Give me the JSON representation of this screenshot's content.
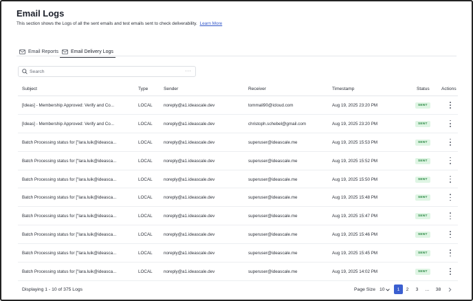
{
  "header": {
    "title": "Email Logs",
    "description": "This section shows the Logs of all the sent emails and test emails sent to check deliverability.",
    "learn_more": "Learn More"
  },
  "tabs": [
    {
      "label": "Email Reports",
      "icon": "mail-icon",
      "active": false
    },
    {
      "label": "Email Delivery Logs",
      "icon": "mail-icon",
      "active": true
    }
  ],
  "search": {
    "placeholder": "Search",
    "value": "",
    "more": "···"
  },
  "table": {
    "columns": [
      "Subject",
      "Type",
      "Sender",
      "Receiver",
      "Timestamp",
      "Status",
      "Actions"
    ],
    "rows": [
      {
        "subject": "[Ideas] - Membership Approved: Verify and Co...",
        "type": "LOCAL",
        "sender": "noreply@a1.ideascale.dev",
        "receiver": "tommali90@icloud.com",
        "timestamp": "Aug 19, 2025 23:20 PM",
        "status": "SENT"
      },
      {
        "subject": "[Ideas] - Membership Approved: Verify and Co...",
        "type": "LOCAL",
        "sender": "noreply@a1.ideascale.dev",
        "receiver": "christoph.schebel@gmail.com",
        "timestamp": "Aug 19, 2025 23:20 PM",
        "status": "SENT"
      },
      {
        "subject": "Batch Processing status for [\"lara.luik@ideasca...",
        "type": "LOCAL",
        "sender": "noreply@a1.ideascale.dev",
        "receiver": "superuser@ideascale.me",
        "timestamp": "Aug 19, 2025 15:53 PM",
        "status": "SENT"
      },
      {
        "subject": "Batch Processing status for [\"lara.luik@ideasca...",
        "type": "LOCAL",
        "sender": "noreply@a1.ideascale.dev",
        "receiver": "superuser@ideascale.me",
        "timestamp": "Aug 19, 2025 15:52 PM",
        "status": "SENT"
      },
      {
        "subject": "Batch Processing status for [\"lara.luik@ideasca...",
        "type": "LOCAL",
        "sender": "noreply@a1.ideascale.dev",
        "receiver": "superuser@ideascale.me",
        "timestamp": "Aug 19, 2025 15:50 PM",
        "status": "SENT"
      },
      {
        "subject": "Batch Processing status for [\"lara.luik@ideasca...",
        "type": "LOCAL",
        "sender": "noreply@a1.ideascale.dev",
        "receiver": "superuser@ideascale.me",
        "timestamp": "Aug 19, 2025 15:48 PM",
        "status": "SENT"
      },
      {
        "subject": "Batch Processing status for [\"lara.luik@ideasca...",
        "type": "LOCAL",
        "sender": "noreply@a1.ideascale.dev",
        "receiver": "superuser@ideascale.me",
        "timestamp": "Aug 19, 2025 15:47 PM",
        "status": "SENT"
      },
      {
        "subject": "Batch Processing status for [\"lara.luik@ideasca...",
        "type": "LOCAL",
        "sender": "noreply@a1.ideascale.dev",
        "receiver": "superuser@ideascale.me",
        "timestamp": "Aug 19, 2025 15:46 PM",
        "status": "SENT"
      },
      {
        "subject": "Batch Processing status for [\"lara.luik@ideasca...",
        "type": "LOCAL",
        "sender": "noreply@a1.ideascale.dev",
        "receiver": "superuser@ideascale.me",
        "timestamp": "Aug 19, 2025 15:45 PM",
        "status": "SENT"
      },
      {
        "subject": "Batch Processing status for [\"lara.luik@ideasca...",
        "type": "LOCAL",
        "sender": "noreply@a1.ideascale.dev",
        "receiver": "superuser@ideascale.me",
        "timestamp": "Aug 19, 2025 14:02 PM",
        "status": "SENT"
      }
    ]
  },
  "footer": {
    "count_text": "Displaying 1 - 10 of 375 Logs",
    "page_size_label": "Page Size",
    "page_size_value": "10",
    "pages": [
      "1",
      "2",
      "3",
      "...",
      "38"
    ],
    "current_page": "1"
  },
  "colors": {
    "accent": "#3b5fd0",
    "link": "#2f54c8",
    "status_bg": "#dff5e4",
    "status_text": "#2c8a45"
  }
}
